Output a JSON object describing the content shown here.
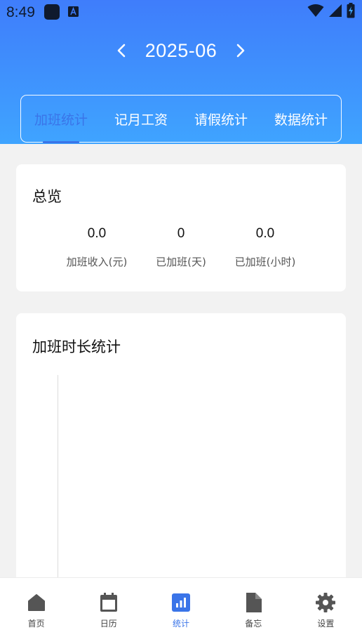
{
  "status_bar": {
    "time": "8:49",
    "icons": [
      "app-icon",
      "keyboard-a-icon",
      "wifi-icon",
      "signal-icon",
      "battery-charging-icon"
    ]
  },
  "header": {
    "month": "2025-06",
    "prev_icon": "chevron-left-icon",
    "next_icon": "chevron-right-icon"
  },
  "tabs": [
    {
      "label": "加班统计",
      "active": true
    },
    {
      "label": "记月工资",
      "active": false
    },
    {
      "label": "请假统计",
      "active": false
    },
    {
      "label": "数据统计",
      "active": false
    }
  ],
  "overview": {
    "title": "总览",
    "stats": [
      {
        "value": "0.0",
        "label": "加班收入(元)"
      },
      {
        "value": "0",
        "label": "已加班(天)"
      },
      {
        "value": "0.0",
        "label": "已加班(小时)"
      }
    ]
  },
  "chart_card": {
    "title": "加班时长统计"
  },
  "bottom_nav": [
    {
      "label": "首页",
      "icon": "home-icon",
      "active": false
    },
    {
      "label": "日历",
      "icon": "calendar-icon",
      "active": false
    },
    {
      "label": "统计",
      "icon": "chart-icon",
      "active": true
    },
    {
      "label": "备忘",
      "icon": "document-icon",
      "active": false
    },
    {
      "label": "设置",
      "icon": "gear-icon",
      "active": false
    }
  ],
  "colors": {
    "accent": "#3a74e8",
    "header_top": "#3f7dfb",
    "header_bottom": "#3fa4ff",
    "inactive_icon": "#555555"
  }
}
